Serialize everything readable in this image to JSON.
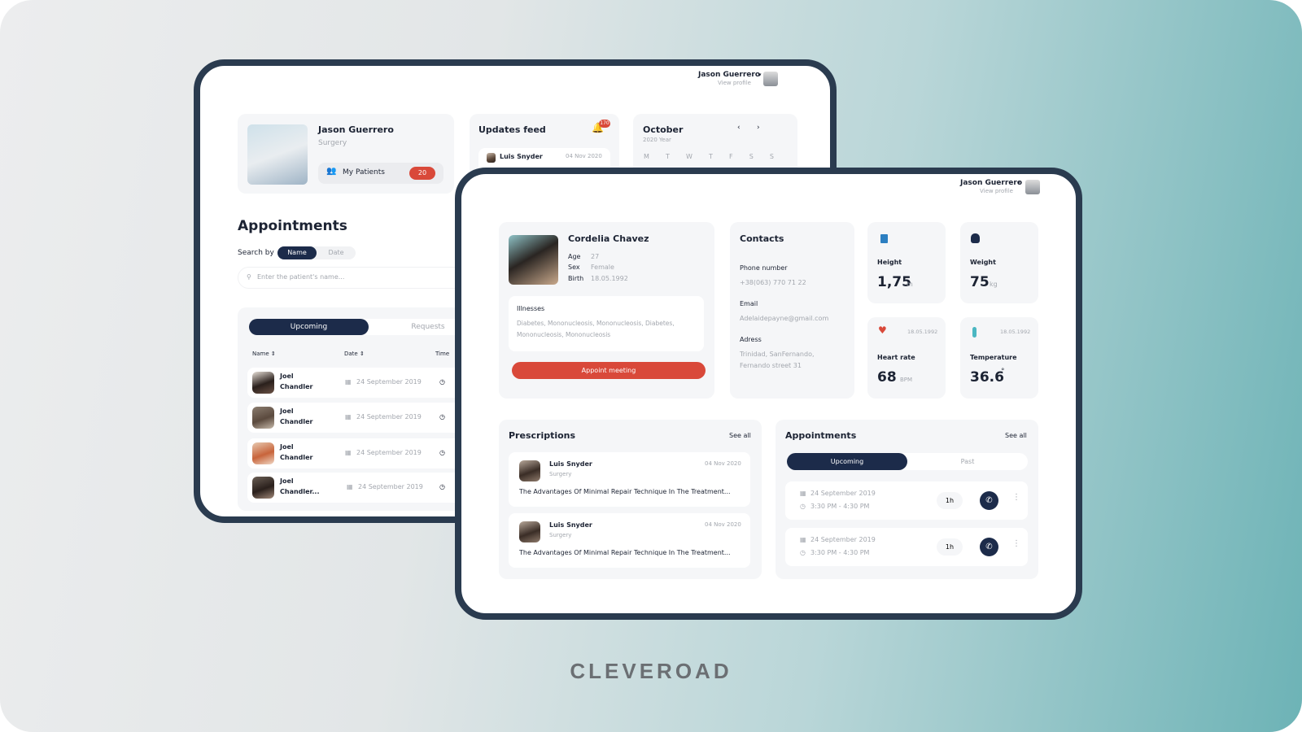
{
  "brand": "CLEVEROAD",
  "colors": {
    "navy": "#1c2b4a",
    "accent_red": "#d9493a",
    "frame": "#2a3b4f",
    "card": "#f5f6f8"
  },
  "back": {
    "user": {
      "name": "Jason Guerrero",
      "link": "View profile"
    },
    "doctor": {
      "name": "Jason Guerrero",
      "specialty": "Surgery",
      "patients_label": "My Patients",
      "patients_count": "20"
    },
    "updates": {
      "title": "Updates feed",
      "badge": "170",
      "item_name": "Luis Snyder",
      "item_date": "04 Nov 2020"
    },
    "calendar": {
      "month": "October",
      "year": "2020 Year",
      "days": [
        "M",
        "T",
        "W",
        "T",
        "F",
        "S",
        "S"
      ]
    },
    "appointments": {
      "title": "Appointments",
      "search_by": "Search by",
      "toggle": [
        "Name",
        "Date"
      ],
      "placeholder": "Enter the patient's name...",
      "tabs": [
        "Upcoming",
        "Requests"
      ],
      "columns": [
        "Name",
        "Date",
        "Time"
      ],
      "rows": [
        {
          "first": "Joel",
          "last": "Chandler",
          "date": "24 September 2019"
        },
        {
          "first": "Joel",
          "last": "Chandler",
          "date": "24 September 2019"
        },
        {
          "first": "Joel",
          "last": "Chandler",
          "date": "24 September 2019"
        },
        {
          "first": "Joel",
          "last": "Chandler...",
          "date": "24 September 2019"
        }
      ]
    }
  },
  "front": {
    "user": {
      "name": "Jason Guerrero",
      "link": "View profile"
    },
    "patient": {
      "name": "Cordelia Chavez",
      "fields": [
        {
          "label": "Age",
          "value": "27"
        },
        {
          "label": "Sex",
          "value": "Female"
        },
        {
          "label": "Birth",
          "value": "18.05.1992"
        }
      ],
      "illnesses_title": "Illnesses",
      "illnesses": "Diabetes, Mononucleosis, Mononucleosis, Diabetes,",
      "illnesses2": "Mononucleosis, Mononucleosis",
      "button": "Appoint meeting"
    },
    "contacts": {
      "title": "Contacts",
      "phone_label": "Phone number",
      "phone": "+38(063) 770 71 22",
      "email_label": "Email",
      "email": "Adelaidepayne@gmail.com",
      "address_label": "Adress",
      "address1": "Trinidad, SanFernando,",
      "address2": "Fernando street 31"
    },
    "metrics": {
      "height": {
        "label": "Height",
        "value": "1,75",
        "unit": "m"
      },
      "weight": {
        "label": "Weight",
        "value": "75",
        "unit": "kg"
      },
      "heart": {
        "label": "Heart rate",
        "value": "68",
        "unit": "BPM",
        "date": "18.05.1992"
      },
      "temp": {
        "label": "Temperature",
        "value": "36.6",
        "unit": "°",
        "date": "18.05.1992"
      }
    },
    "prescriptions": {
      "title": "Prescriptions",
      "see_all": "See all",
      "items": [
        {
          "name": "Luis Snyder",
          "specialty": "Surgery",
          "date": "04 Nov 2020",
          "text": "The Advantages Of Minimal Repair Technique In The Treatment..."
        },
        {
          "name": "Luis Snyder",
          "specialty": "Surgery",
          "date": "04 Nov 2020",
          "text": "The Advantages Of Minimal Repair Technique In The Treatment..."
        }
      ]
    },
    "appointments": {
      "title": "Appointments",
      "see_all": "See all",
      "tabs": [
        "Upcoming",
        "Past"
      ],
      "items": [
        {
          "date": "24 September 2019",
          "time": "3:30 PM - 4:30 PM",
          "duration": "1h"
        },
        {
          "date": "24 September 2019",
          "time": "3:30 PM - 4:30 PM",
          "duration": "1h"
        }
      ]
    }
  }
}
